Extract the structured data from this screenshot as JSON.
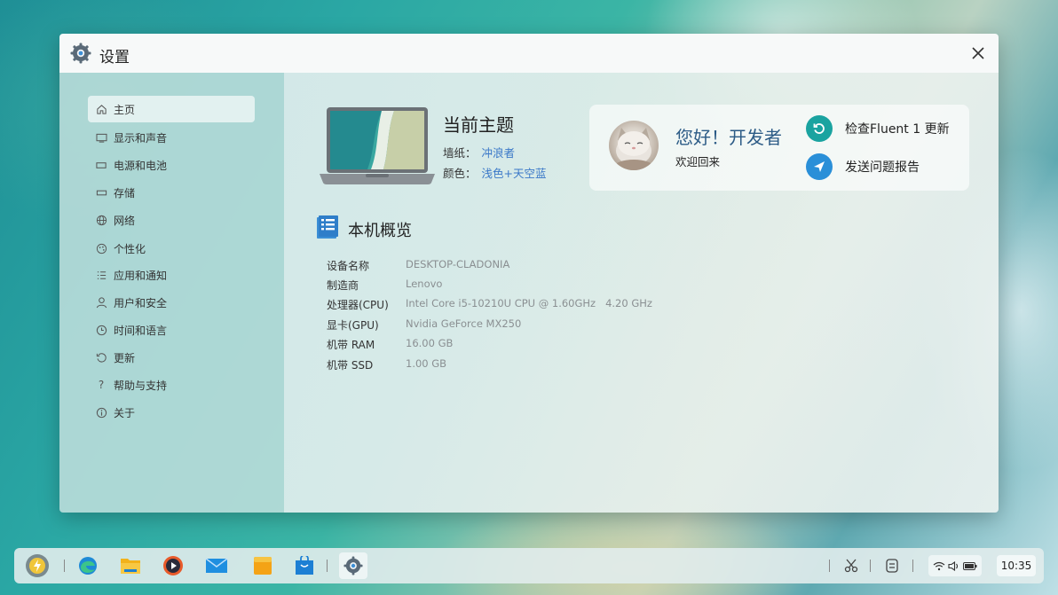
{
  "window": {
    "title": "设置",
    "close_icon": "close-icon"
  },
  "sidebar": {
    "items": [
      {
        "label": "主页",
        "icon": "home-icon"
      },
      {
        "label": "显示和声音",
        "icon": "display-icon"
      },
      {
        "label": "电源和电池",
        "icon": "battery-icon"
      },
      {
        "label": "存储",
        "icon": "storage-icon"
      },
      {
        "label": "网络",
        "icon": "globe-icon"
      },
      {
        "label": "个性化",
        "icon": "palette-icon"
      },
      {
        "label": "应用和通知",
        "icon": "apps-list-icon"
      },
      {
        "label": "用户和安全",
        "icon": "user-icon"
      },
      {
        "label": "时间和语言",
        "icon": "clock-icon"
      },
      {
        "label": "更新",
        "icon": "refresh-icon"
      },
      {
        "label": "帮助与支持",
        "icon": "question-icon"
      },
      {
        "label": "关于",
        "icon": "info-icon"
      }
    ]
  },
  "theme": {
    "title": "当前主题",
    "wallpaper_label": "墙纸：",
    "wallpaper_value": "冲浪者",
    "color_label": "颜色：",
    "color_value": "浅色+天空蓝"
  },
  "user_card": {
    "greeting": "您好！开发者",
    "welcome": "欢迎回来",
    "check_update": "检查Fluent 1 更新",
    "report_issue": "发送问题报告"
  },
  "overview": {
    "title": "本机概览",
    "specs": [
      {
        "label": "设备名称",
        "value": "DESKTOP-CLADONIA"
      },
      {
        "label": "制造商",
        "value": "Lenovo"
      },
      {
        "label": "处理器(CPU)",
        "value": "Intel Core i5-10210U CPU @ 1.60GHz   4.20 GHz"
      },
      {
        "label": "显卡(GPU)",
        "value": "Nvidia GeForce MX250"
      },
      {
        "label": "机带 RAM",
        "value": "16.00 GB"
      },
      {
        "label": "机带 SSD",
        "value": "1.00 GB"
      }
    ]
  },
  "taskbar": {
    "clock": "10:35",
    "apps": [
      "launcher-icon",
      "edge-icon",
      "file-explorer-icon",
      "media-player-icon",
      "mail-icon",
      "notes-icon",
      "store-icon",
      "settings-icon"
    ],
    "tray": [
      "wifi-icon",
      "volume-icon",
      "battery-icon"
    ]
  },
  "colors": {
    "accent": "#3a78c8",
    "greeting": "#2c5b86",
    "update_icon": "#1aa3a0",
    "report_icon": "#2a8fd8"
  }
}
